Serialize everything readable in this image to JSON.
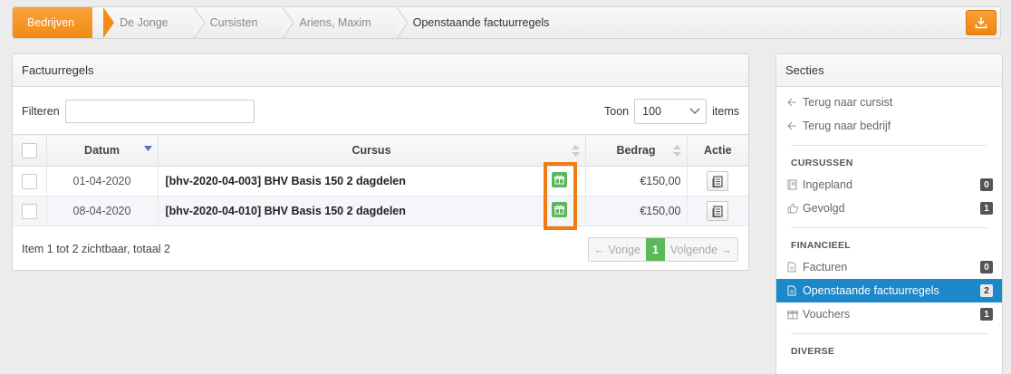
{
  "breadcrumb": {
    "items": [
      "Bedrijven",
      "De Jonge",
      "Cursisten",
      "Ariens, Maxim",
      "Openstaande factuurregels"
    ],
    "download_icon": "download-icon"
  },
  "main": {
    "title": "Factuurregels",
    "filter_label": "Filteren",
    "filter_value": "",
    "show_label": "Toon",
    "page_size": "100",
    "items_label": "items",
    "columns": [
      "Datum",
      "Cursus",
      "Bedrag",
      "Actie"
    ],
    "rows": [
      {
        "date": "01-04-2020",
        "course": "[bhv-2020-04-003] BHV Basis 150 2 dagdelen",
        "amount": "€150,00"
      },
      {
        "date": "08-04-2020",
        "course": "[bhv-2020-04-010] BHV Basis 150 2 dagdelen",
        "amount": "€150,00"
      }
    ],
    "footer": "Item 1 tot 2 zichtbaar, totaal 2",
    "pager": {
      "prev": "← Vorige",
      "current": "1",
      "next": "Volgende →"
    }
  },
  "side": {
    "title": "Secties",
    "links": [
      "Terug naar cursist",
      "Terug naar bedrijf"
    ],
    "sections": [
      {
        "title": "CURSUSSEN",
        "items": [
          {
            "label": "Ingepland",
            "count": "0"
          },
          {
            "label": "Gevolgd",
            "count": "1"
          }
        ]
      },
      {
        "title": "FINANCIEEL",
        "items": [
          {
            "label": "Facturen",
            "count": "0"
          },
          {
            "label": "Openstaande factuurregels",
            "count": "2"
          },
          {
            "label": "Vouchers",
            "count": "1"
          }
        ]
      },
      {
        "title": "DIVERSE"
      }
    ]
  },
  "colors": {
    "accent_orange": "#f28a14",
    "active_blue": "#1c87c9",
    "success_green": "#5cb85c"
  }
}
